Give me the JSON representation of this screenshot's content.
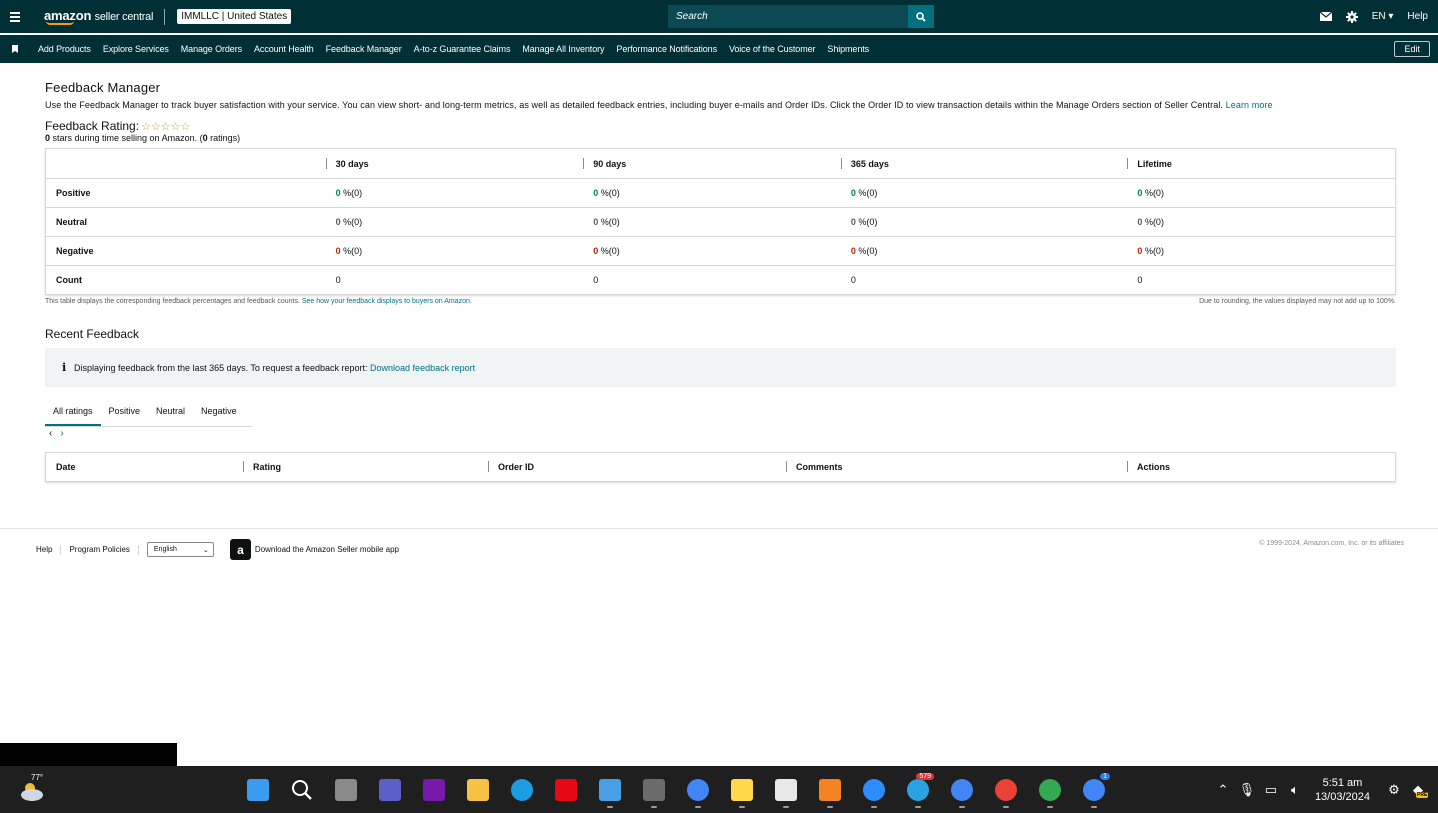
{
  "topbar": {
    "logo_brand": "amazon",
    "logo_product": "seller central",
    "account": "IMMLLC | United States",
    "search_placeholder": "Search",
    "language": "EN",
    "help": "Help"
  },
  "nav": {
    "items": [
      "Add Products",
      "Explore Services",
      "Manage Orders",
      "Account Health",
      "Feedback Manager",
      "A-to-z Guarantee Claims",
      "Manage All Inventory",
      "Performance Notifications",
      "Voice of the Customer",
      "Shipments"
    ],
    "edit": "Edit"
  },
  "page": {
    "title": "Feedback Manager",
    "description": "Use the Feedback Manager to track buyer satisfaction with your service. You can view short- and long-term metrics, as well as detailed feedback entries, including buyer e-mails and Order IDs. Click the Order ID to view transaction details within the Manage Orders section of Seller Central.",
    "learn_more": "Learn more",
    "rating_label": "Feedback Rating:",
    "stars": "☆☆☆☆☆",
    "stars_count": "0",
    "stars_text": " stars during time selling on Amazon. (",
    "ratings_count": "0",
    "ratings_text": " ratings)"
  },
  "feedback_table": {
    "headers": [
      "30 days",
      "90 days",
      "365 days",
      "Lifetime"
    ],
    "rows": [
      {
        "label": "Positive",
        "values": [
          "0",
          "0",
          "0",
          "0"
        ],
        "suffix": "%(0)",
        "color": "#067d62"
      },
      {
        "label": "Neutral",
        "values": [
          "0",
          "0",
          "0",
          "0"
        ],
        "suffix": "%(0)",
        "color": "#565959"
      },
      {
        "label": "Negative",
        "values": [
          "0",
          "0",
          "0",
          "0"
        ],
        "suffix": "%(0)",
        "color": "#b12704"
      }
    ],
    "count_label": "Count",
    "counts": [
      "0",
      "0",
      "0",
      "0"
    ],
    "note_left": "This table displays the corresponding feedback percentages and feedback counts.",
    "note_link": "See how your feedback displays to buyers on Amazon.",
    "note_right": "Due to rounding, the values displayed may not add up to 100%."
  },
  "recent": {
    "title": "Recent Feedback",
    "alert_text": "Displaying feedback from the last 365 days. To request a feedback report:",
    "alert_link": "Download feedback report",
    "tabs": [
      "All ratings",
      "Positive",
      "Neutral",
      "Negative"
    ],
    "active_tab": "All ratings",
    "columns": [
      "Date",
      "Rating",
      "Order ID",
      "Comments",
      "Actions"
    ]
  },
  "footer": {
    "help": "Help",
    "policies": "Program Policies",
    "language": "English",
    "app_badge": "a",
    "app_text": "Download the Amazon Seller mobile app",
    "copyright": "© 1999-2024, Amazon.com, Inc. or its affiliates"
  },
  "taskbar": {
    "temperature": "77°",
    "time": "5:51 am",
    "date": "13/03/2024",
    "telegram_badge": "579",
    "chrome_badge": "1",
    "copilot_badge": "PRE",
    "apps": [
      {
        "name": "windows-start-icon",
        "color": "#3a9bf0"
      },
      {
        "name": "search-icon",
        "color": "#1f1f1f"
      },
      {
        "name": "task-view-icon",
        "color": "#8a8a8a"
      },
      {
        "name": "teams-icon",
        "color": "#5b5fc7"
      },
      {
        "name": "onenote-icon",
        "color": "#7719aa"
      },
      {
        "name": "file-explorer-icon",
        "color": "#f6c244"
      },
      {
        "name": "edge-icon",
        "color": "#1b9de2"
      },
      {
        "name": "netflix-icon",
        "color": "#e50914"
      },
      {
        "name": "notepad-icon",
        "color": "#4a9ee8"
      },
      {
        "name": "calculator-icon",
        "color": "#6b6b6b"
      },
      {
        "name": "chrome-icon",
        "color": "#4285f4"
      },
      {
        "name": "sticky-notes-icon",
        "color": "#ffd94a"
      },
      {
        "name": "snipping-tool-icon",
        "color": "#e8e8e8"
      },
      {
        "name": "ringcentral-icon",
        "color": "#f58220"
      },
      {
        "name": "zoom-icon",
        "color": "#2d8cff"
      },
      {
        "name": "telegram-icon",
        "color": "#2aa3e0"
      },
      {
        "name": "chrome-profile-1-icon",
        "color": "#4285f4"
      },
      {
        "name": "chrome-profile-2-icon",
        "color": "#ea4335"
      },
      {
        "name": "chrome-profile-3-icon",
        "color": "#34a853"
      },
      {
        "name": "chrome-profile-4-icon",
        "color": "#4285f4"
      }
    ]
  }
}
